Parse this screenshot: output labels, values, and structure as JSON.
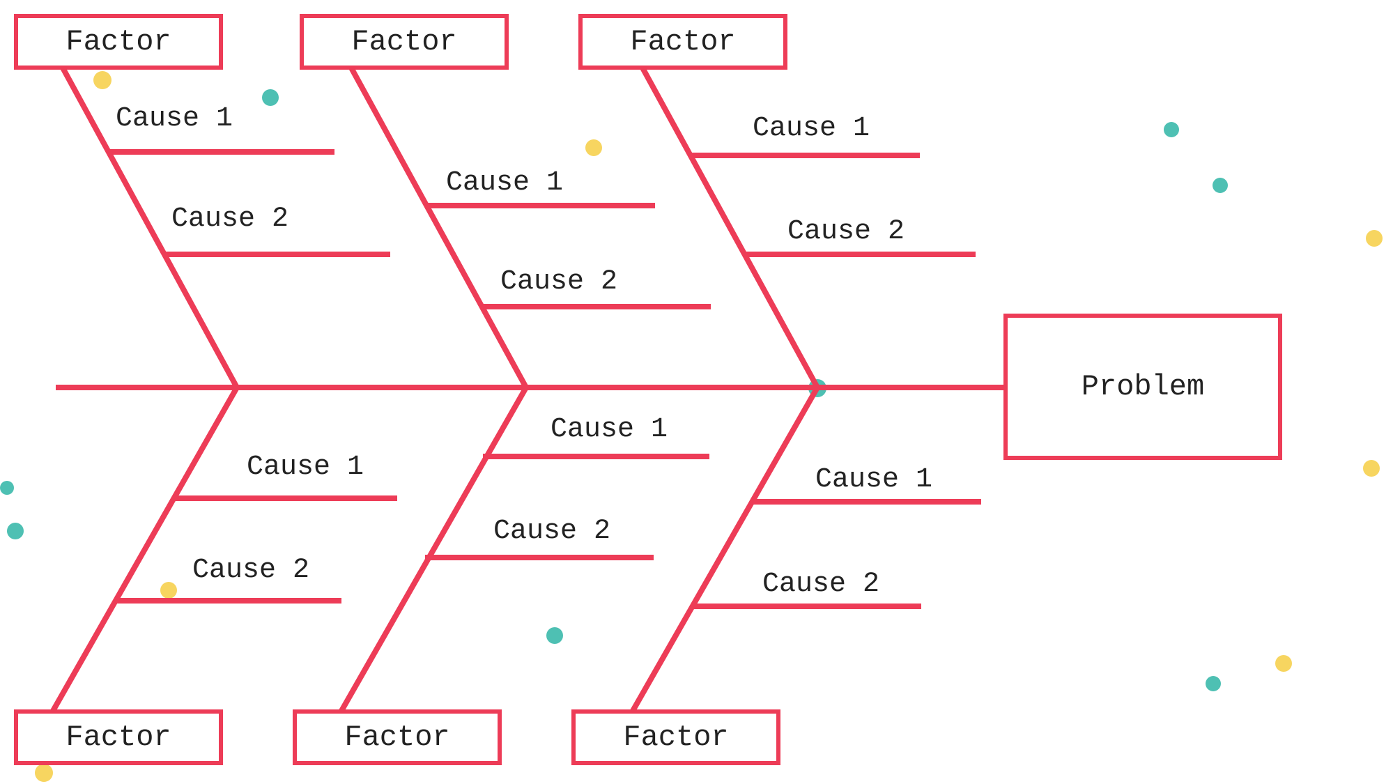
{
  "colors": {
    "stroke": "#ED3C57",
    "teal_dot": "#4EC0B3",
    "yellow_dot": "#F7D560",
    "background": "#ffffff"
  },
  "problem": {
    "label": "Problem"
  },
  "factors": {
    "top": [
      {
        "label": "Factor",
        "causes": [
          "Cause 1",
          "Cause 2"
        ]
      },
      {
        "label": "Factor",
        "causes": [
          "Cause 1",
          "Cause 2"
        ]
      },
      {
        "label": "Factor",
        "causes": [
          "Cause 1",
          "Cause 2"
        ]
      }
    ],
    "bottom": [
      {
        "label": "Factor",
        "causes": [
          "Cause 1",
          "Cause 2"
        ]
      },
      {
        "label": "Factor",
        "causes": [
          "Cause 1",
          "Cause 2"
        ]
      },
      {
        "label": "Factor",
        "causes": [
          "Cause 1",
          "Cause 2"
        ]
      }
    ]
  }
}
